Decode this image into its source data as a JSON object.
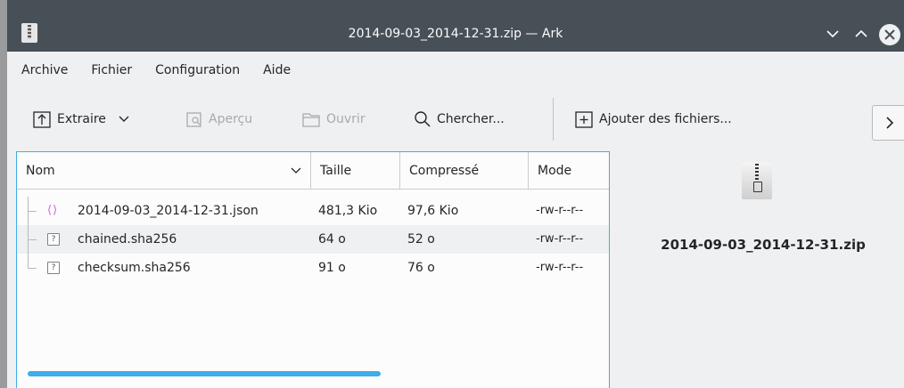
{
  "window": {
    "title": "2014-09-03_2014-12-31.zip — Ark"
  },
  "menubar": {
    "items": [
      "Archive",
      "Fichier",
      "Configuration",
      "Aide"
    ]
  },
  "toolbar": {
    "extract_label": "Extraire",
    "preview_label": "Aperçu",
    "open_label": "Ouvrir",
    "search_label": "Chercher...",
    "add_files_label": "Ajouter des fichiers..."
  },
  "table": {
    "columns": [
      "Nom",
      "Taille",
      "Compressé",
      "Mode"
    ],
    "rows": [
      {
        "icon": "json-file-icon",
        "name": "2014-09-03_2014-12-31.json",
        "size": "481,3 Kio",
        "compressed": "97,6 Kio",
        "mode": "-rw-r--r--"
      },
      {
        "icon": "unknown-file-icon",
        "name": "chained.sha256",
        "size": "64 o",
        "compressed": "52 o",
        "mode": "-rw-r--r--"
      },
      {
        "icon": "unknown-file-icon",
        "name": "checksum.sha256",
        "size": "91 o",
        "compressed": "76 o",
        "mode": "-rw-r--r--"
      }
    ]
  },
  "info_panel": {
    "icon": "zip-archive-icon",
    "filename": "2014-09-03_2014-12-31.zip"
  },
  "colors": {
    "titlebar": "#475057",
    "accent": "#3daee9",
    "background": "#eff0f1"
  }
}
